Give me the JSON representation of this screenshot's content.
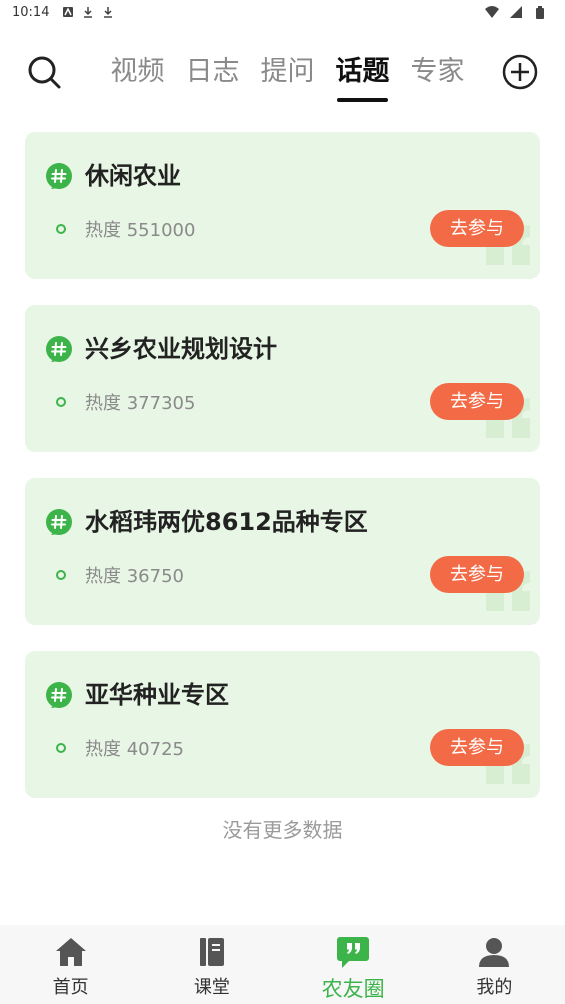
{
  "status_bar": {
    "time": "10:14"
  },
  "top_nav": {
    "tabs": [
      {
        "label": "视频"
      },
      {
        "label": "日志"
      },
      {
        "label": "提问"
      },
      {
        "label": "话题"
      },
      {
        "label": "专家"
      }
    ],
    "active_tab": "话题"
  },
  "topics": [
    {
      "title": "休闲农业",
      "heat": "热度 551000",
      "join_label": "去参与"
    },
    {
      "title": "兴乡农业规划设计",
      "heat": "热度 377305",
      "join_label": "去参与"
    },
    {
      "title": "水稻玮两优8612品种专区",
      "heat": "热度 36750",
      "join_label": "去参与"
    },
    {
      "title": "亚华种业专区",
      "heat": "热度 40725",
      "join_label": "去参与"
    }
  ],
  "no_more_text": "没有更多数据",
  "bottom_nav": {
    "items": [
      {
        "label": "首页",
        "icon": "home-icon"
      },
      {
        "label": "课堂",
        "icon": "book-icon"
      },
      {
        "label": "农友圈",
        "icon": "quote-chat-icon"
      },
      {
        "label": "我的",
        "icon": "user-icon"
      }
    ],
    "active": "农友圈"
  },
  "colors": {
    "accent_green": "#3cb44a",
    "card_bg": "#e8f6e5",
    "join_orange": "#f26b46"
  }
}
